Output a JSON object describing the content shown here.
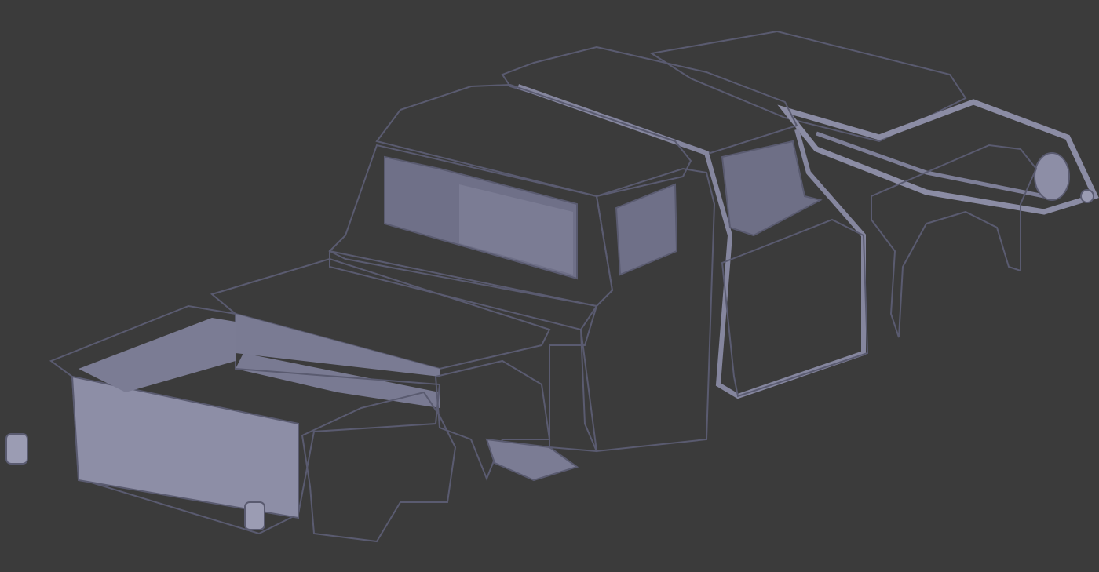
{
  "viewport": {
    "background": "#3b3b3b",
    "model_color": "#8a8ba3",
    "model_shadow": "#6a6b82",
    "model_highlight": "#a6a7bd"
  },
  "model": {
    "parts": [
      "cab-shell",
      "extended-cab-roof",
      "rear-roof-and-frame",
      "bed-box",
      "bed-fender",
      "front-fender",
      "cab-door",
      "tail-light-left",
      "tail-light-right"
    ]
  }
}
